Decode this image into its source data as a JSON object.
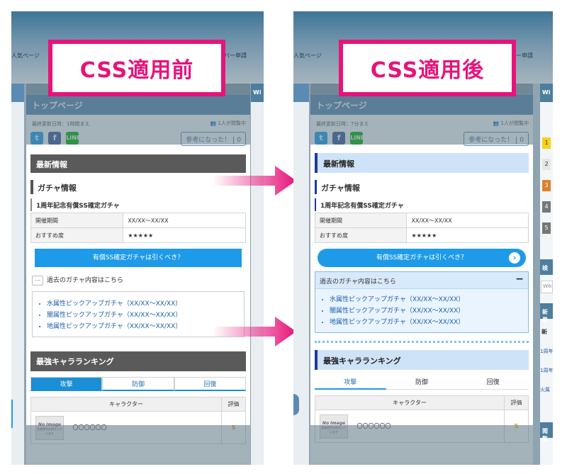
{
  "labels": {
    "before": "CSS適用前",
    "after": "CSS適用後"
  },
  "nav": {
    "left_item": "人気ページ",
    "right_item": "バー申請"
  },
  "page": {
    "title": "トップページ",
    "sidebar_header_partial": "Wi",
    "reader_count": "1人が閲覧中",
    "helpful_label": "参考になった！",
    "helpful_count": "0"
  },
  "before": {
    "last_updated": "最終更新日時：1時間まえ",
    "section_heading": "最新情報",
    "subheading": "ガチャ情報",
    "gacha_title": "1周年記念有償SS確定ガチャ",
    "table": [
      {
        "label": "開催期間",
        "value": "XX/XX〜XX/XX"
      },
      {
        "label": "おすすめ度",
        "value": "★★★★★"
      }
    ],
    "cta": "有償SS確定ガチャは引くべき？",
    "past_toggle": "過去のガチャ内容はこちら",
    "past_list": [
      "水属性ピックアップガチャ（XX/XX〜XX/XX）",
      "闇属性ピックアップガチャ（XX/XX〜XX/XX）",
      "地属性ピックアップガチャ（XX/XX〜XX/XX）"
    ],
    "ranking_heading": "最強キャラランキング",
    "tabs": [
      "攻撃",
      "防御",
      "回復"
    ],
    "rank_headers": [
      "キャラクター",
      "評価"
    ],
    "rank_rows": [
      {
        "name": "〇〇〇〇〇〇",
        "grade": "S",
        "img_text": "No Image",
        "img_sub": "画像提供お待ちしています"
      }
    ]
  },
  "after": {
    "last_updated": "最終更新日時：7分まえ",
    "section_heading": "最新情報",
    "subheading": "ガチャ情報",
    "gacha_title": "1周年記念有償SS確定ガチャ",
    "table": [
      {
        "label": "開催期間",
        "value": "XX/XX〜XX/XX"
      },
      {
        "label": "おすすめ度",
        "value": "★★★★★"
      }
    ],
    "cta": "有償SS確定ガチャは引くべき？",
    "cta_arrow": "›",
    "past_toggle": "過去のガチャ内容はこちら",
    "past_toggle_icon": "−",
    "past_list": [
      "水属性ピックアップガチャ（XX/XX〜XX/XX）",
      "闇属性ピックアップガチャ（XX/XX〜XX/XX）",
      "地属性ピックアップガチャ（XX/XX〜XX/XX）"
    ],
    "ranking_heading": "最強キャラランキング",
    "tabs": [
      "攻撃",
      "防御",
      "回復"
    ],
    "rank_headers": [
      "キャラクター",
      "評価"
    ],
    "rank_rows": [
      {
        "name": "〇〇〇〇〇〇",
        "grade": "S",
        "img_text": "No Image",
        "img_sub": "画像提供お待ちしています"
      }
    ]
  },
  "right_sidebar": {
    "ranks": [
      "1",
      "2",
      "3",
      "4",
      "5"
    ],
    "search_head": "検",
    "search_placeholder": "Wiki",
    "news_head": "新着",
    "news_sub": "新",
    "news_items": [
      "1周年",
      "1周年",
      "火属"
    ],
    "bottom_head": "閲覧"
  },
  "colors": {
    "accent": "#e6147a",
    "link": "#1c5fa5",
    "cta": "#1e9be8",
    "heading_before": "#5a5a5a",
    "heading_after": "#cfe3f8"
  }
}
